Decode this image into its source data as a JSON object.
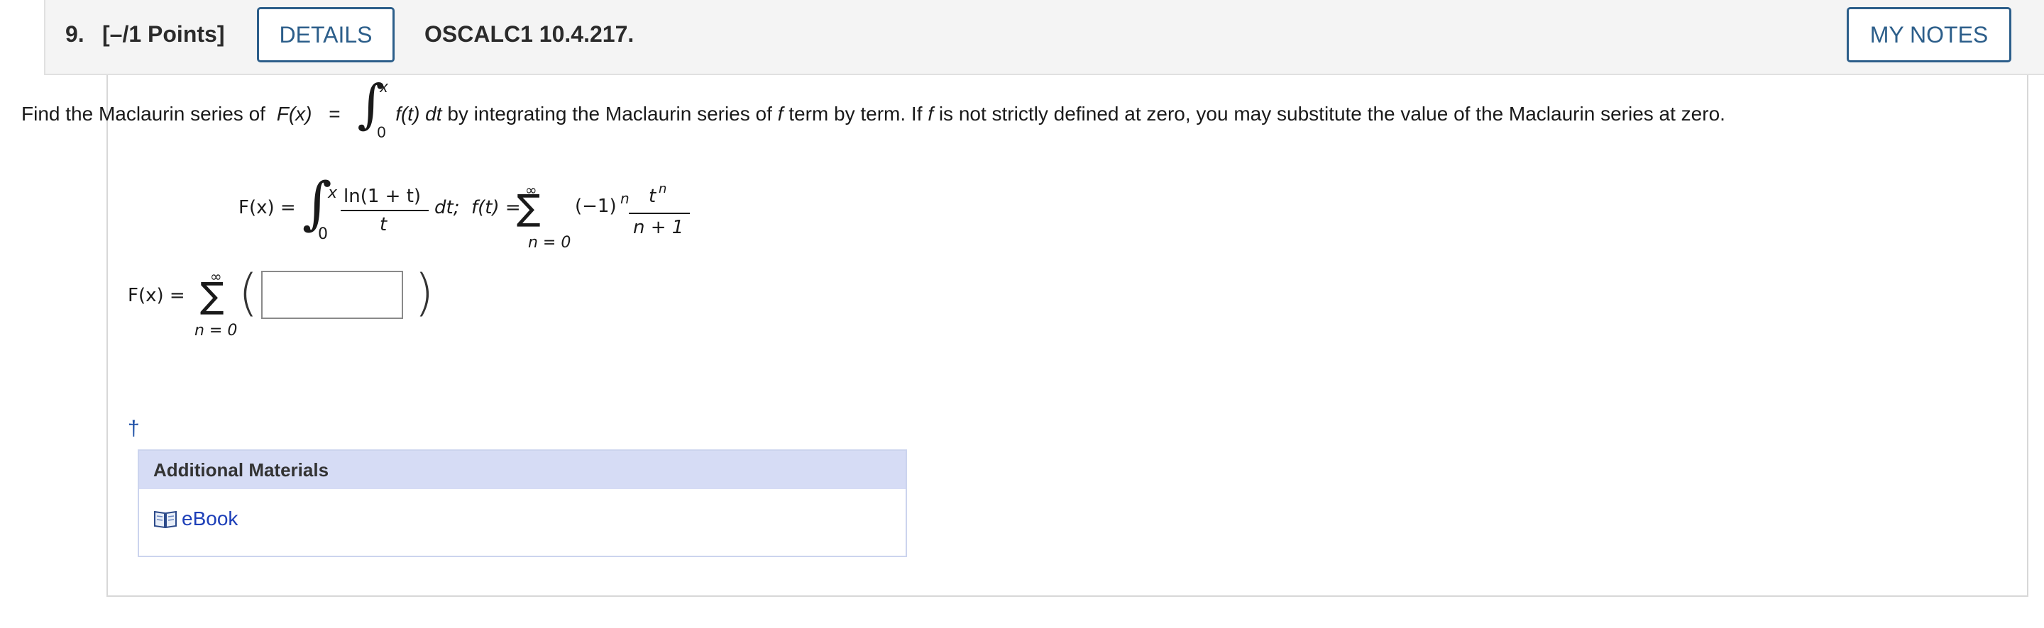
{
  "header": {
    "number": "9.",
    "points": "[–/1 Points]",
    "details_label": "DETAILS",
    "code": "OSCALC1 10.4.217.",
    "notes_label": "MY NOTES"
  },
  "question": {
    "prompt_before": "Find the Maclaurin series of",
    "fx": "F(x)",
    "eq": "=",
    "upper": "x",
    "lower": "0",
    "integrand": "f(t) dt",
    "prompt_mid": " by integrating the Maclaurin series of ",
    "f1": "f",
    "prompt_mid2": " term by term. If ",
    "f2": "f",
    "prompt_end": " is not strictly defined at zero, you may substitute the value of the Maclaurin series at zero."
  },
  "given": {
    "lhs": "F(x) =",
    "upper": "x",
    "lower": "0",
    "numerator": "ln(1 + t)",
    "denominator": "t",
    "dt_sep": "dt;  f(t) =",
    "sum_top": "∞",
    "sum_bottom": "n = 0",
    "term": "(−1)",
    "exp": "n",
    "frac_num": "t",
    "frac_num_exp": "n",
    "frac_den": "n + 1"
  },
  "answer": {
    "lhs": "F(x) =",
    "sum_top": "∞",
    "sum_bottom": "n = 0",
    "value": ""
  },
  "dagger": "†",
  "additional": {
    "title": "Additional Materials",
    "ebook_label": "eBook"
  }
}
